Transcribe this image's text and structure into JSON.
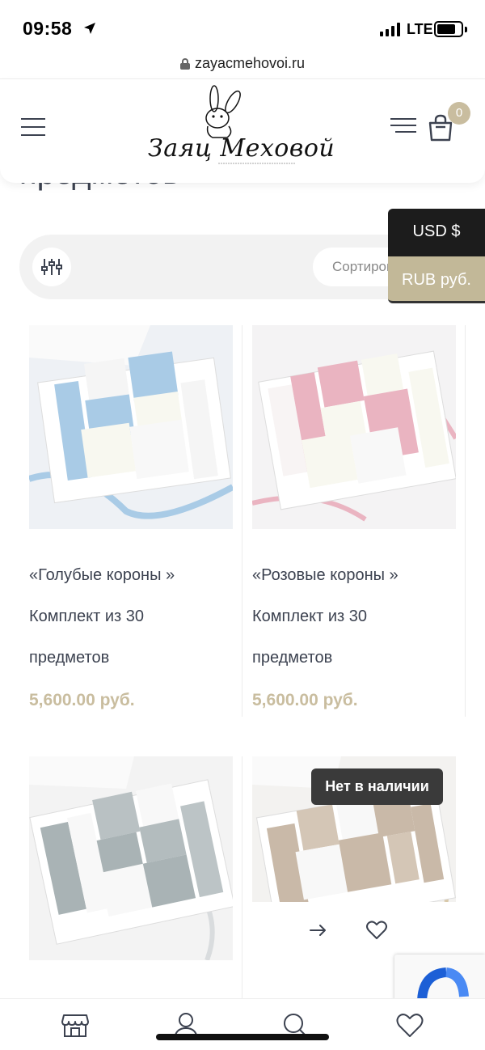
{
  "status_bar": {
    "time": "09:58",
    "network": "LTE"
  },
  "browser": {
    "url": "zayacmehovoi.ru"
  },
  "header": {
    "logo_text": "Заяц Меховой",
    "cart_count": "0"
  },
  "page": {
    "heading": "предметов"
  },
  "filter": {
    "sort_placeholder": "Сортировка"
  },
  "currency": {
    "options": [
      "USD $",
      "RUB руб."
    ],
    "selected": "RUB руб."
  },
  "products": [
    {
      "title": "«Голубые короны »",
      "subtitle": "Комплект из 30",
      "subtitle2": "предметов",
      "price": "5,600.00 руб.",
      "accent": "#a9cbe6"
    },
    {
      "title": "«Розовые короны »",
      "subtitle": "Комплект из 30",
      "subtitle2": "предметов",
      "price": "5,600.00 руб.",
      "accent": "#eab4c1"
    },
    {
      "title": "",
      "subtitle": "",
      "subtitle2": "",
      "price": "",
      "accent": "#a9b3b5"
    },
    {
      "title": "",
      "subtitle": "",
      "subtitle2": "",
      "price": "",
      "accent": "#c9b9a8",
      "badge": "Нет в наличии"
    }
  ],
  "colors": {
    "price": "#c9bd9f",
    "text": "#3c4250",
    "usd_bg": "#1c1c1c",
    "rub_bg": "#c2b898"
  },
  "bottom_nav": [
    "shop-icon",
    "user-icon",
    "search-icon",
    "heart-icon"
  ]
}
